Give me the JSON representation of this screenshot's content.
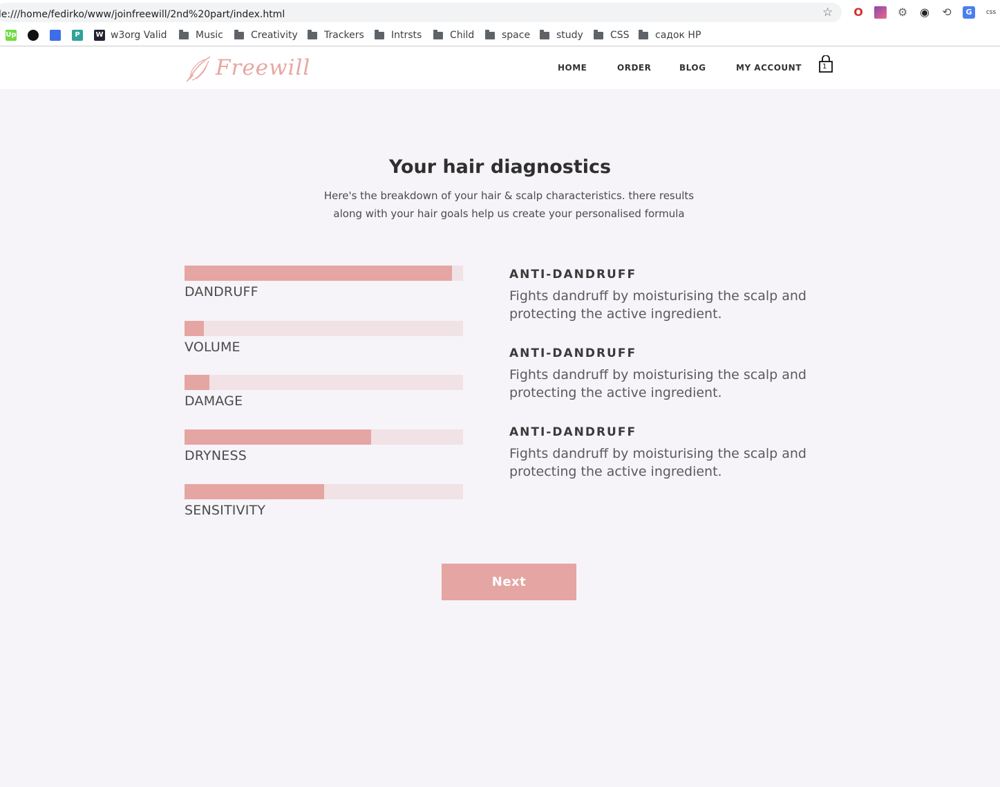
{
  "browser": {
    "url": "ile:///home/fedirko/www/joinfreewill/2nd%20part/index.html",
    "bookmarks": [
      {
        "label": "",
        "icon": "upwork-icon"
      },
      {
        "label": "",
        "icon": "github-icon"
      },
      {
        "label": "",
        "icon": "bitwarden-icon"
      },
      {
        "label": "",
        "icon": "pocket-icon"
      },
      {
        "label": "w3org Valid",
        "icon": "w3c-icon"
      },
      {
        "label": "Music",
        "icon": "folder-icon"
      },
      {
        "label": "Creativity",
        "icon": "folder-icon"
      },
      {
        "label": "Trackers",
        "icon": "folder-icon"
      },
      {
        "label": "Intrsts",
        "icon": "folder-icon"
      },
      {
        "label": "Child",
        "icon": "folder-icon"
      },
      {
        "label": "space",
        "icon": "folder-icon"
      },
      {
        "label": "study",
        "icon": "folder-icon"
      },
      {
        "label": "CSS",
        "icon": "folder-icon"
      },
      {
        "label": "садок HP",
        "icon": "folder-icon"
      }
    ],
    "extensions_css_label": "css"
  },
  "header": {
    "logo_text": "Freewill",
    "nav": {
      "home": "HOME",
      "order": "ORDER",
      "blog": "BLOG",
      "account": "MY ACCOUNT"
    },
    "cart_count": "1"
  },
  "main": {
    "title": "Your hair diagnostics",
    "subtitle_line1": "Here's the breakdown of your hair & scalp characteristics. there results",
    "subtitle_line2": "along with your hair goals help us create your personalised formula",
    "metrics": [
      {
        "label": "DANDRUFF",
        "level": 0.96
      },
      {
        "label": "VOLUME",
        "level": 0.07
      },
      {
        "label": "DAMAGE",
        "level": 0.09
      },
      {
        "label": "DRYNESS",
        "level": 0.67
      },
      {
        "label": "SENSITIVITY",
        "level": 0.5
      }
    ],
    "benefits": [
      {
        "title": "ANTI-DANDRUFF",
        "text_line1": "Fights dandruff by moisturising the scalp and",
        "text_line2": "protecting the active ingredient."
      },
      {
        "title": "ANTI-DANDRUFF",
        "text_line1": "Fights dandruff by moisturising the scalp and",
        "text_line2": "protecting the active ingredient."
      },
      {
        "title": "ANTI-DANDRUFF",
        "text_line1": "Fights dandruff by moisturising the scalp and",
        "text_line2": "protecting the active ingredient."
      }
    ],
    "next_label": "Next"
  },
  "colors": {
    "accent": "#e5a5a3",
    "track": "#f0e2e5",
    "page_background": "#f6f4f8"
  }
}
